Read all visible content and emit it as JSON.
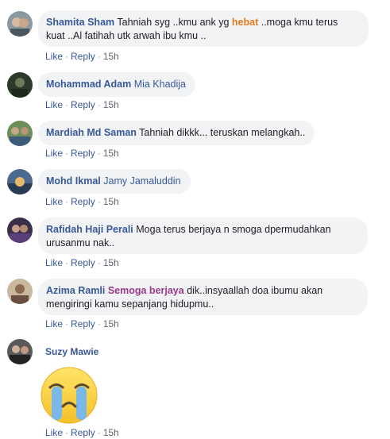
{
  "actions": {
    "like": "Like",
    "reply": "Reply",
    "sep": "·"
  },
  "comments": [
    {
      "name": "Shamita Sham",
      "pre": "Tahniah syg ..kmu ank yg ",
      "highlight": "hebat",
      "post": " ..moga kmu terus",
      "line2": "kuat ..Al fatihah utk arwah ibu kmu ..",
      "time": "15h"
    },
    {
      "name": "Mohammad Adam",
      "tag": "Mia Khadija",
      "time": "15h"
    },
    {
      "name": "Mardiah Md Saman",
      "text": "Tahniah dikkk... teruskan melangkah..",
      "time": "15h"
    },
    {
      "name": "Mohd Ikmal",
      "tag": "Jamy Jamaluddin",
      "time": "15h"
    },
    {
      "name": "Rafidah Haji Perali",
      "text": "Moga terus berjaya n smoga dpermudahkan",
      "line2": "urusanmu nak..",
      "time": "15h"
    },
    {
      "name": "Azima Ramli",
      "highlight": "Semoga berjaya",
      "post": " dik..insyaallah doa ibumu akan",
      "line2": "mengiringi kamu sepanjang hidupmu..",
      "time": "15h"
    },
    {
      "name": "Suzy Mawie",
      "sticker": "crying-face-sticker",
      "time": "15h"
    }
  ],
  "colors": {
    "name": "#385898",
    "bubble": "#f2f3f5",
    "meta": "#606770",
    "highlight_orange": "#e07b1f",
    "highlight_purple": "#9b3a8b"
  }
}
